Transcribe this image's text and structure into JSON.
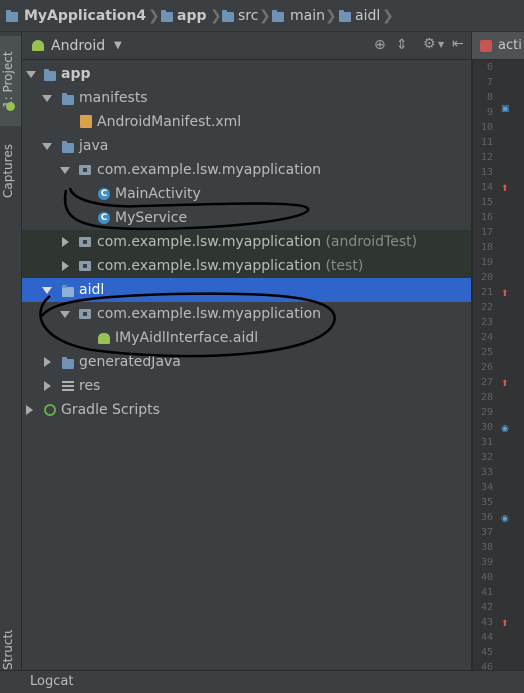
{
  "breadcrumb": {
    "items": [
      "MyApplication4",
      "app",
      "src",
      "main",
      "aidl"
    ]
  },
  "left_strip": {
    "project_tab": "1: Project",
    "captures_tab": "Captures",
    "structure_tab": "Structure"
  },
  "panel": {
    "view_mode": "Android"
  },
  "tree": {
    "app": "app",
    "manifests": "manifests",
    "manifest_file": "AndroidManifest.xml",
    "java": "java",
    "pkg_main": "com.example.lsw.myapplication",
    "main_activity": "MainActivity",
    "my_service": "MyService",
    "pkg_android_test": "com.example.lsw.myapplication",
    "android_test_suffix": "(androidTest)",
    "pkg_test": "com.example.lsw.myapplication",
    "test_suffix": "(test)",
    "aidl": "aidl",
    "pkg_aidl": "com.example.lsw.myapplication",
    "aidl_file": "IMyAidlInterface.aidl",
    "generated_java": "generatedJava",
    "res": "res",
    "gradle_scripts": "Gradle Scripts"
  },
  "editor": {
    "tab_label": "acti",
    "line_numbers": [
      "6",
      "7",
      "8",
      "9",
      "10",
      "11",
      "12",
      "13",
      "14",
      "15",
      "16",
      "17",
      "18",
      "19",
      "20",
      "21",
      "22",
      "23",
      "24",
      "25",
      "26",
      "27",
      "28",
      "29",
      "30",
      "31",
      "32",
      "33",
      "34",
      "35",
      "36",
      "37",
      "38",
      "39",
      "40",
      "41",
      "42",
      "43",
      "44",
      "45",
      "46"
    ]
  },
  "bottom": {
    "logcat": "Logcat"
  },
  "colors": {
    "selection": "#2f65ca",
    "panel_bg": "#3c3f41",
    "folder": "#6f92b5"
  }
}
